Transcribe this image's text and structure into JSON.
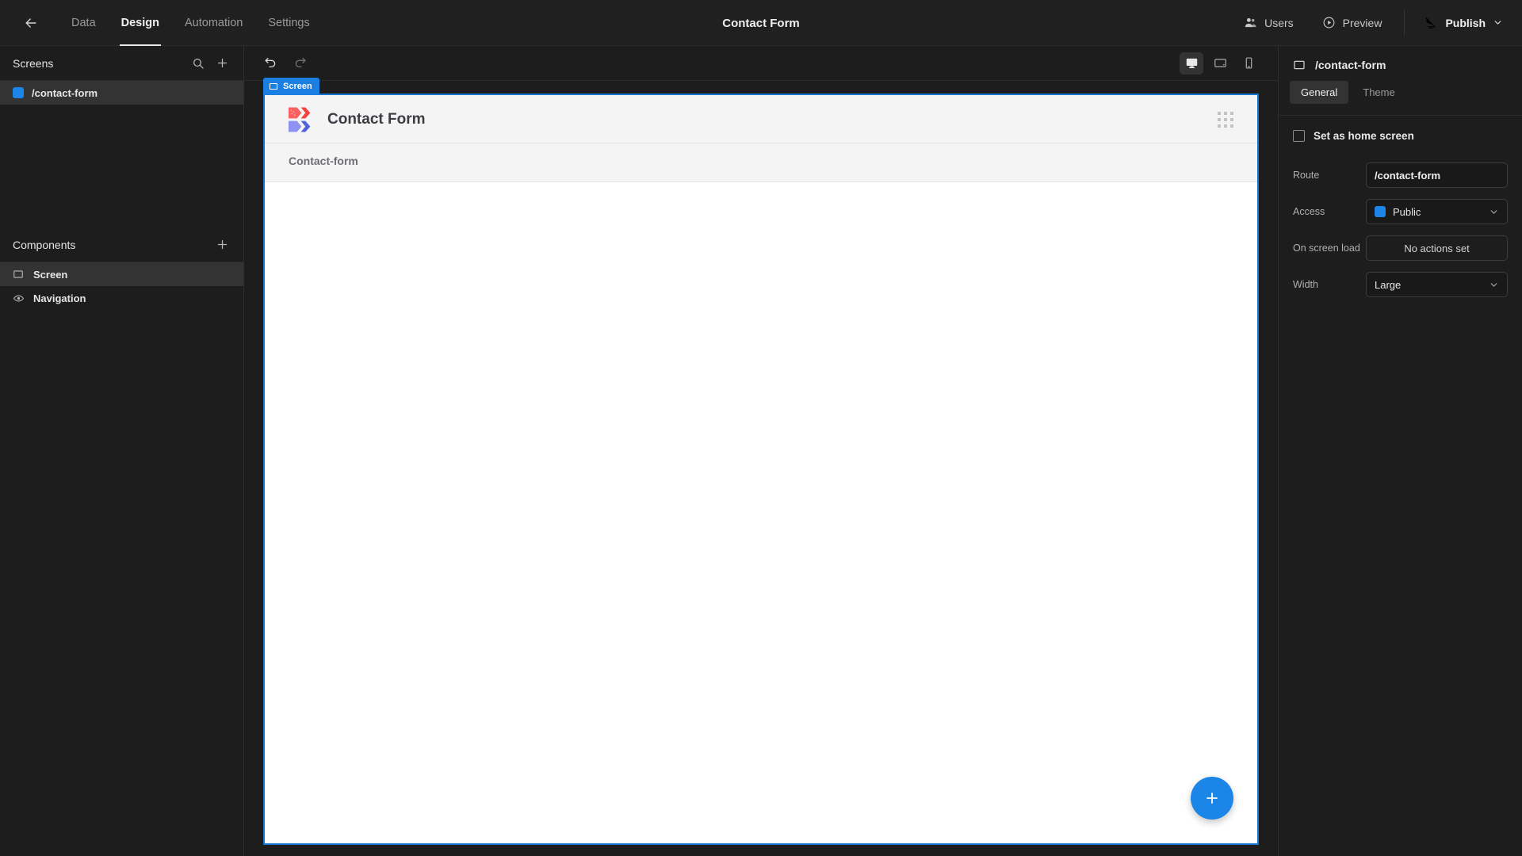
{
  "header": {
    "back_icon": "arrow-left-icon",
    "title": "Contact Form",
    "tabs": [
      {
        "label": "Data",
        "active": false
      },
      {
        "label": "Design",
        "active": true
      },
      {
        "label": "Automation",
        "active": false
      },
      {
        "label": "Settings",
        "active": false
      }
    ],
    "users_label": "Users",
    "preview_label": "Preview",
    "publish_label": "Publish"
  },
  "sidebar_left": {
    "screens": {
      "title": "Screens",
      "search_icon": "search-icon",
      "add_icon": "plus-icon",
      "items": [
        {
          "label": "/contact-form",
          "color": "#1c85e8",
          "selected": true
        }
      ]
    },
    "components": {
      "title": "Components",
      "add_icon": "plus-icon",
      "items": [
        {
          "label": "Screen",
          "icon": "screen-icon",
          "selected": true
        },
        {
          "label": "Navigation",
          "icon": "eye-icon",
          "selected": false
        }
      ]
    }
  },
  "canvas_toolbar": {
    "undo_icon": "undo-icon",
    "redo_icon": "redo-icon",
    "devices": [
      {
        "name": "desktop-icon",
        "active": true
      },
      {
        "name": "tablet-icon",
        "active": false
      },
      {
        "name": "mobile-icon",
        "active": false
      }
    ]
  },
  "canvas": {
    "badge_label": "Screen",
    "badge_icon": "screen-icon",
    "badge_color": "#1a7fe0",
    "app_title": "Contact Form",
    "logo_colors": {
      "top": "#f8615f",
      "bottom": "#8e92f0",
      "top_dark": "#f4433d",
      "bottom_dark": "#4f62e0"
    },
    "nav_link": "Contact-form",
    "fab_icon": "plus-icon",
    "fab_color": "#1c85e8"
  },
  "sidebar_right": {
    "title": "/contact-form",
    "title_icon": "screen-icon",
    "tabs": [
      {
        "label": "General",
        "active": true
      },
      {
        "label": "Theme",
        "active": false
      }
    ],
    "home_screen_label": "Set as home screen",
    "home_screen_checked": false,
    "fields": [
      {
        "label": "Route",
        "value": "/contact-form",
        "type": "input"
      },
      {
        "label": "Access",
        "value": "Public",
        "type": "select",
        "swatch": "#1c85e8"
      },
      {
        "label": "On screen load",
        "value": "No actions set",
        "type": "ghost"
      },
      {
        "label": "Width",
        "value": "Large",
        "type": "select"
      }
    ]
  }
}
